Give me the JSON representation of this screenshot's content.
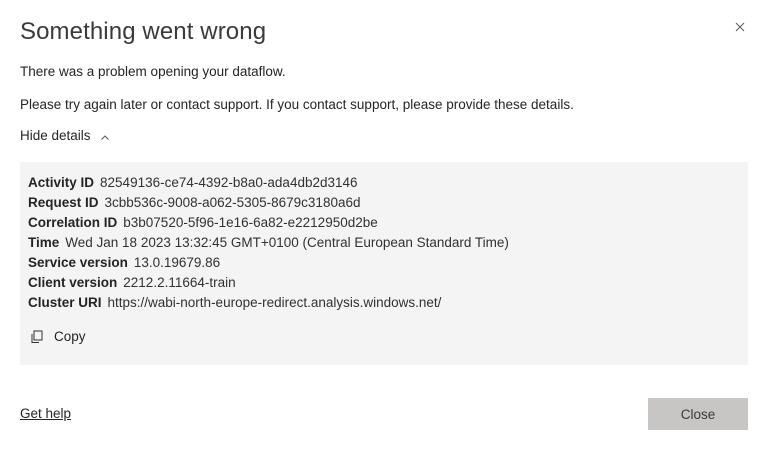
{
  "dialog": {
    "title": "Something went wrong",
    "message_1": "There was a problem opening your dataflow.",
    "message_2": "Please try again later or contact support. If you contact support, please provide these details.",
    "toggle_label": "Hide details",
    "toggle_icon": "chevron-up-icon",
    "close_icon": "close-icon"
  },
  "details": {
    "rows": [
      {
        "key": "Activity ID",
        "value": "82549136-ce74-4392-b8a0-ada4db2d3146"
      },
      {
        "key": "Request ID",
        "value": "3cbb536c-9008-a062-5305-8679c3180a6d"
      },
      {
        "key": "Correlation ID",
        "value": "b3b07520-5f96-1e16-6a82-e2212950d2be"
      },
      {
        "key": "Time",
        "value": "Wed Jan 18 2023 13:32:45 GMT+0100 (Central European Standard Time)"
      },
      {
        "key": "Service version",
        "value": "13.0.19679.86"
      },
      {
        "key": "Client version",
        "value": "2212.2.11664-train"
      },
      {
        "key": "Cluster URI",
        "value": "https://wabi-north-europe-redirect.analysis.windows.net/"
      }
    ],
    "copy_label": "Copy",
    "copy_icon": "copy-icon"
  },
  "footer": {
    "help_label": "Get help",
    "close_label": "Close"
  },
  "colors": {
    "details_bg": "#f4f4f4",
    "close_button_bg": "#c8c6c4",
    "text": "#252423"
  }
}
